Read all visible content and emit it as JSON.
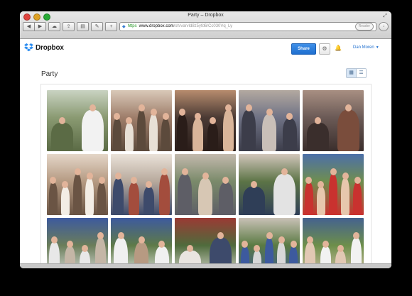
{
  "window": {
    "title": "Party – Dropbox"
  },
  "toolbar": {
    "back_icon": "back-icon",
    "forward_icon": "forward-icon",
    "url_scheme": "https",
    "url_domain": "www.dropbox.com",
    "url_path": "/sh/varvld8z5yfd6/Cc030Vq_Ly",
    "reader_label": "Reader"
  },
  "header": {
    "brand": "Dropbox",
    "share_label": "Share",
    "user_name": "Dan Moren"
  },
  "page": {
    "title": "Party"
  },
  "colors": {
    "accent": "#1f6fcf",
    "dropbox_blue": "#2a8cf0"
  },
  "photos": [
    {
      "alt": "Family group outdoors with balloons",
      "palette": [
        "#8a9a72",
        "#c9d3c2",
        "#5b6b45",
        "#f2f2f2"
      ]
    },
    {
      "alt": "Board covered with photo collage",
      "palette": [
        "#9e7d6a",
        "#d9c9b8",
        "#5c4a3c",
        "#e8e0d6"
      ]
    },
    {
      "alt": "Two young women smiling",
      "palette": [
        "#4a3a34",
        "#b78c6e",
        "#2a1d19",
        "#d9b59a"
      ]
    },
    {
      "alt": "Group of girls and adults",
      "palette": [
        "#6f7285",
        "#b3a9a0",
        "#3c3d4a",
        "#c9bfb8"
      ]
    },
    {
      "alt": "Group of women posing",
      "palette": [
        "#6b5a56",
        "#a88f82",
        "#3a2e2c",
        "#7a4d3c"
      ]
    },
    {
      "alt": "Man standing in kitchen",
      "palette": [
        "#b59a82",
        "#e4d6c8",
        "#6a5444",
        "#f3ede5"
      ]
    },
    {
      "alt": "Older couple with family indoors",
      "palette": [
        "#b7a99c",
        "#eae2d9",
        "#3d4a6b",
        "#a34d3d"
      ]
    },
    {
      "alt": "Group of older people outdoors",
      "palette": [
        "#7a8a6a",
        "#c3b9ad",
        "#5e5e66",
        "#d7c7b4"
      ]
    },
    {
      "alt": "Couples standing in garden",
      "palette": [
        "#5c7446",
        "#d1c5ba",
        "#2f3e57",
        "#e3e3e3"
      ]
    },
    {
      "alt": "Man and young man on lawn",
      "palette": [
        "#6f8e4f",
        "#4c6fa8",
        "#c9322f",
        "#e7c7ad"
      ]
    },
    {
      "alt": "Large family group seated",
      "palette": [
        "#6a7d5a",
        "#3d5a9e",
        "#e8e8e8",
        "#c4b6a6"
      ]
    },
    {
      "alt": "Couple seated on bench",
      "palette": [
        "#5e7a48",
        "#3d5a9e",
        "#f0f0f0",
        "#b79a82"
      ]
    },
    {
      "alt": "Family standing in yard",
      "palette": [
        "#4f6b3c",
        "#9a3a34",
        "#e9e5e0",
        "#3d4a6b"
      ]
    },
    {
      "alt": "Family group with patterned shirts",
      "palette": [
        "#5a7a42",
        "#c9c1b6",
        "#3d5a9e",
        "#d8d8d8"
      ]
    },
    {
      "alt": "Extended family group on grass",
      "palette": [
        "#6d8e4a",
        "#44628f",
        "#e2c8b4",
        "#f2f2f2"
      ]
    }
  ]
}
